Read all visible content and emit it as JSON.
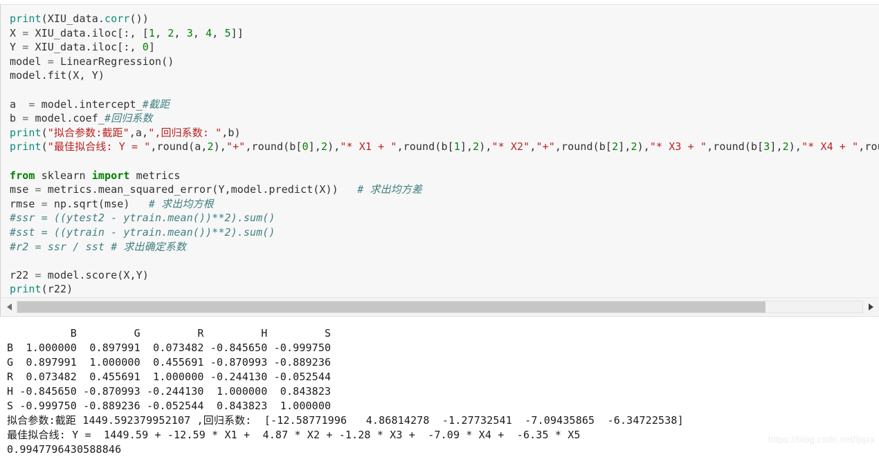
{
  "code_cell": {
    "lines": [
      [
        {
          "t": "fn",
          "s": "print"
        },
        {
          "t": "plain",
          "s": "(XIU_data."
        },
        {
          "t": "fn",
          "s": "corr"
        },
        {
          "t": "plain",
          "s": "())"
        }
      ],
      [
        {
          "t": "plain",
          "s": "X "
        },
        {
          "t": "op",
          "s": "="
        },
        {
          "t": "plain",
          "s": " XIU_data.iloc[:, ["
        },
        {
          "t": "num",
          "s": "1"
        },
        {
          "t": "plain",
          "s": ", "
        },
        {
          "t": "num",
          "s": "2"
        },
        {
          "t": "plain",
          "s": ", "
        },
        {
          "t": "num",
          "s": "3"
        },
        {
          "t": "plain",
          "s": ", "
        },
        {
          "t": "num",
          "s": "4"
        },
        {
          "t": "plain",
          "s": ", "
        },
        {
          "t": "num",
          "s": "5"
        },
        {
          "t": "plain",
          "s": "]]"
        }
      ],
      [
        {
          "t": "plain",
          "s": "Y "
        },
        {
          "t": "op",
          "s": "="
        },
        {
          "t": "plain",
          "s": " XIU_data.iloc[:, "
        },
        {
          "t": "num",
          "s": "0"
        },
        {
          "t": "plain",
          "s": "]"
        }
      ],
      [
        {
          "t": "plain",
          "s": "model "
        },
        {
          "t": "op",
          "s": "="
        },
        {
          "t": "plain",
          "s": " LinearRegression()"
        }
      ],
      [
        {
          "t": "plain",
          "s": "model.fit(X, Y)"
        }
      ],
      [],
      [
        {
          "t": "plain",
          "s": "a  "
        },
        {
          "t": "op",
          "s": "="
        },
        {
          "t": "plain",
          "s": " model.intercept_"
        },
        {
          "t": "com",
          "s": "#截距"
        }
      ],
      [
        {
          "t": "plain",
          "s": "b "
        },
        {
          "t": "op",
          "s": "="
        },
        {
          "t": "plain",
          "s": " model.coef_"
        },
        {
          "t": "com",
          "s": "#回归系数"
        }
      ],
      [
        {
          "t": "fn",
          "s": "print"
        },
        {
          "t": "plain",
          "s": "("
        },
        {
          "t": "str",
          "s": "\"拟合参数:截距\""
        },
        {
          "t": "plain",
          "s": ",a,"
        },
        {
          "t": "str",
          "s": "\",回归系数: \""
        },
        {
          "t": "plain",
          "s": ",b)"
        }
      ],
      [
        {
          "t": "fn",
          "s": "print"
        },
        {
          "t": "plain",
          "s": "("
        },
        {
          "t": "str",
          "s": "\"最佳拟合线: Y = \""
        },
        {
          "t": "plain",
          "s": ",round(a,"
        },
        {
          "t": "num",
          "s": "2"
        },
        {
          "t": "plain",
          "s": "),"
        },
        {
          "t": "str",
          "s": "\"+\""
        },
        {
          "t": "plain",
          "s": ",round(b["
        },
        {
          "t": "num",
          "s": "0"
        },
        {
          "t": "plain",
          "s": "],"
        },
        {
          "t": "num",
          "s": "2"
        },
        {
          "t": "plain",
          "s": "),"
        },
        {
          "t": "str",
          "s": "\"* X1 + \""
        },
        {
          "t": "plain",
          "s": ",round(b["
        },
        {
          "t": "num",
          "s": "1"
        },
        {
          "t": "plain",
          "s": "],"
        },
        {
          "t": "num",
          "s": "2"
        },
        {
          "t": "plain",
          "s": "),"
        },
        {
          "t": "str",
          "s": "\"* X2\""
        },
        {
          "t": "plain",
          "s": ","
        },
        {
          "t": "str",
          "s": "\"+\""
        },
        {
          "t": "plain",
          "s": ",round(b["
        },
        {
          "t": "num",
          "s": "2"
        },
        {
          "t": "plain",
          "s": "],"
        },
        {
          "t": "num",
          "s": "2"
        },
        {
          "t": "plain",
          "s": "),"
        },
        {
          "t": "str",
          "s": "\"* X3 + \""
        },
        {
          "t": "plain",
          "s": ",round(b["
        },
        {
          "t": "num",
          "s": "3"
        },
        {
          "t": "plain",
          "s": "],"
        },
        {
          "t": "num",
          "s": "2"
        },
        {
          "t": "plain",
          "s": "),"
        },
        {
          "t": "str",
          "s": "\"* X4 + \""
        },
        {
          "t": "plain",
          "s": ",round("
        }
      ],
      [],
      [
        {
          "t": "kw",
          "s": "from"
        },
        {
          "t": "plain",
          "s": " sklearn "
        },
        {
          "t": "kw",
          "s": "import"
        },
        {
          "t": "plain",
          "s": " metrics"
        }
      ],
      [
        {
          "t": "plain",
          "s": "mse "
        },
        {
          "t": "op",
          "s": "="
        },
        {
          "t": "plain",
          "s": " metrics.mean_squared_error(Y,model.predict(X))   "
        },
        {
          "t": "com",
          "s": "# 求出均方差"
        }
      ],
      [
        {
          "t": "plain",
          "s": "rmse "
        },
        {
          "t": "op",
          "s": "="
        },
        {
          "t": "plain",
          "s": " np.sqrt(mse)   "
        },
        {
          "t": "com",
          "s": "# 求出均方根"
        }
      ],
      [
        {
          "t": "com",
          "s": "#ssr = ((ytest2 - ytrain.mean())**2).sum()"
        }
      ],
      [
        {
          "t": "com",
          "s": "#sst = ((ytrain - ytrain.mean())**2).sum()"
        }
      ],
      [
        {
          "t": "com",
          "s": "#r2 = ssr / sst # 求出确定系数"
        }
      ],
      [],
      [
        {
          "t": "plain",
          "s": "r22 "
        },
        {
          "t": "op",
          "s": "="
        },
        {
          "t": "plain",
          "s": " model.score(X,Y)"
        }
      ],
      [
        {
          "t": "fn",
          "s": "print"
        },
        {
          "t": "plain",
          "s": "(r22)"
        }
      ]
    ],
    "scrollbar": {
      "left_arrow_icon": "triangle-left-icon",
      "right_arrow_icon": "triangle-right-icon",
      "thumb_fraction": 0.885
    }
  },
  "output": {
    "lines": [
      "          B         G         R         H         S",
      "B  1.000000  0.897991  0.073482 -0.845650 -0.999750",
      "G  0.897991  1.000000  0.455691 -0.870993 -0.889236",
      "R  0.073482  0.455691  1.000000 -0.244130 -0.052544",
      "H -0.845650 -0.870993 -0.244130  1.000000  0.843823",
      "S -0.999750 -0.889236 -0.052544  0.843823  1.000000",
      "拟合参数:截距 1449.592379952107 ,回归系数:  [-12.58771996   4.86814278  -1.27732541  -7.09435865  -6.34722538]",
      "最佳拟合线: Y =  1449.59 + -12.59 * X1 +  4.87 * X2 + -1.28 * X3 +  -7.09 * X4 +  -6.35 * X5",
      "0.9947796430588846"
    ],
    "correlation_matrix": {
      "columns": [
        "B",
        "G",
        "R",
        "H",
        "S"
      ],
      "rows": [
        {
          "label": "B",
          "values": [
            "1.000000",
            "0.897991",
            "0.073482",
            "-0.845650",
            "-0.999750"
          ]
        },
        {
          "label": "G",
          "values": [
            "0.897991",
            "1.000000",
            "0.455691",
            "-0.870993",
            "-0.889236"
          ]
        },
        {
          "label": "R",
          "values": [
            "0.073482",
            "0.455691",
            "1.000000",
            "-0.244130",
            "-0.052544"
          ]
        },
        {
          "label": "H",
          "values": [
            "-0.845650",
            "-0.870993",
            "-0.244130",
            "1.000000",
            "0.843823"
          ]
        },
        {
          "label": "S",
          "values": [
            "-0.999750",
            "-0.889236",
            "-0.052544",
            "0.843823",
            "1.000000"
          ]
        }
      ]
    },
    "regression": {
      "intercept": "1449.592379952107",
      "coefficients": [
        "-12.58771996",
        "4.86814278",
        "-1.27732541",
        "-7.09435865",
        "-6.34722538"
      ],
      "fit_line": "Y =  1449.59 + -12.59 * X1 +  4.87 * X2 + -1.28 * X3 +  -7.09 * X4 +  -6.35 * X5",
      "r_squared": "0.9947796430588846"
    }
  },
  "watermark": {
    "text": "https://blog.csdn.net/ljqxx"
  },
  "colors": {
    "keyword": "#008000",
    "string": "#ba2121",
    "comment": "#408080",
    "number": "#008000",
    "function": "#0e8a78",
    "cell_background": "#f7f7f7",
    "output_background": "#ffffff"
  }
}
